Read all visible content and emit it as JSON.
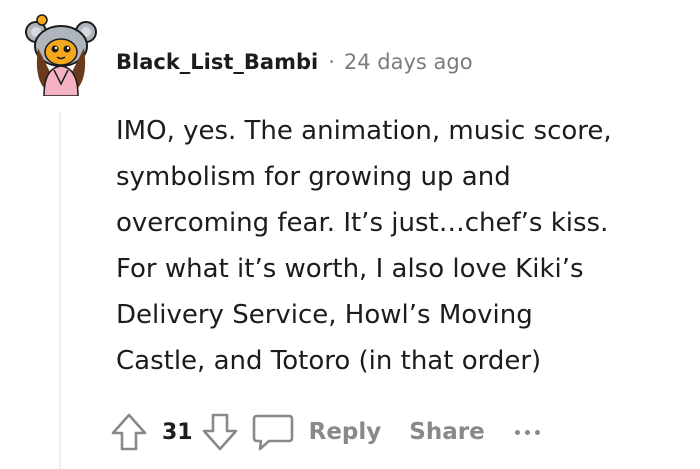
{
  "comment": {
    "username": "Black_List_Bambi",
    "separator": "·",
    "timestamp": "24 days ago",
    "body_lines": [
      "IMO, yes. The animation, music score,",
      "symbolism for growing up and",
      "overcoming fear. It’s just…chef’s kiss.",
      "For what it’s worth, I also love Kiki’s",
      "Delivery Service, Howl’s Moving",
      "Castle, and Totoro (in that order)"
    ]
  },
  "actions": {
    "upvote_icon": "arrow-up-icon",
    "vote_count": "31",
    "downvote_icon": "arrow-down-icon",
    "reply_icon": "speech-bubble-icon",
    "reply_label": "Reply",
    "share_label": "Share",
    "more_icon": "ellipsis-icon"
  },
  "colors": {
    "text": "#1c1c1c",
    "muted": "#7c7c7c",
    "action_gray": "#878a8c",
    "thread_line": "#edeff1"
  }
}
